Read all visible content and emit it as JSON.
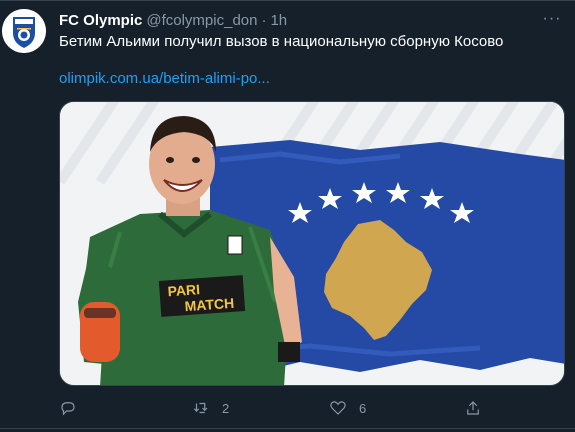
{
  "tweet": {
    "display_name": "FC Olympic",
    "handle": "@fcolympic_don",
    "separator": "·",
    "time": "1h",
    "text": "Бетим Альими получил вызов в национальную сборную Косово",
    "link": "olimpik.com.ua/betim-alimi-po...",
    "more_label": "···"
  },
  "media": {
    "sponsor_line1": "PARI",
    "sponsor_line2": "MATCH",
    "flag_stars": 6
  },
  "actions": {
    "reply_count": "",
    "retweet_count": "2",
    "like_count": "6"
  },
  "colors": {
    "background": "#15202b",
    "link": "#1da1f2",
    "muted": "#8899a6",
    "kosovo_blue": "#244aa5",
    "kosovo_gold": "#d0a650",
    "jersey_green": "#2e6b3a"
  },
  "icons": [
    "olympic-logo-icon",
    "more-icon",
    "reply-icon",
    "retweet-icon",
    "like-icon",
    "share-icon"
  ]
}
